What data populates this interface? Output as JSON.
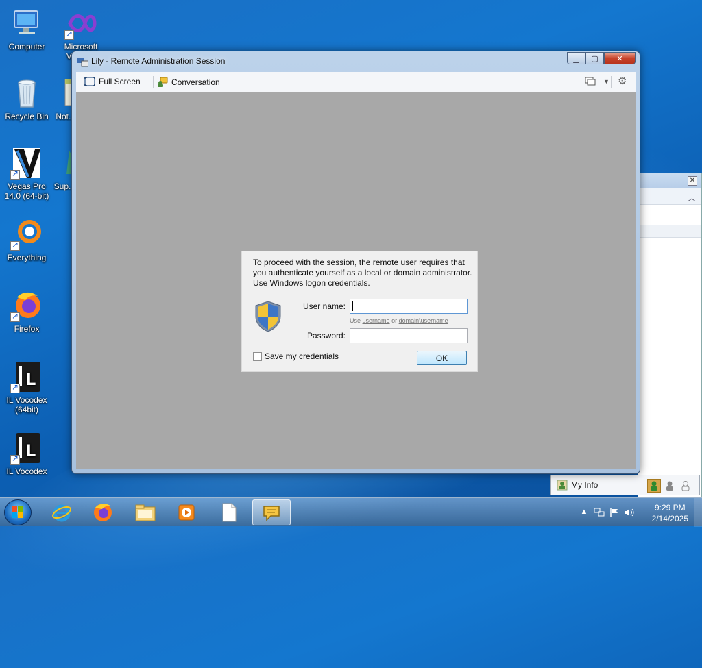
{
  "desktop": {
    "icons": [
      {
        "label": "Computer",
        "icon": "computer-icon"
      },
      {
        "label": "Microsoft Visual...",
        "icon": "visual-studio-icon"
      },
      {
        "label": "Recycle Bin",
        "icon": "recycle-bin-icon"
      },
      {
        "label": "Not...",
        "icon": "notepad-icon"
      },
      {
        "label": "Vegas Pro 14.0 (64-bit)",
        "icon": "vegas-pro-icon"
      },
      {
        "label": "Sup...",
        "icon": "app-icon"
      },
      {
        "label": "Everything",
        "icon": "everything-icon"
      },
      {
        "label": "Firefox",
        "icon": "firefox-icon"
      },
      {
        "label": "IL Vocodex (64bit)",
        "icon": "il-vocodex-icon"
      },
      {
        "label": "IL Vocodex",
        "icon": "il-vocodex-icon"
      }
    ]
  },
  "window": {
    "title": "Lily - Remote Administration Session",
    "toolbar": {
      "full_screen": "Full Screen",
      "conversation": "Conversation"
    }
  },
  "auth_dialog": {
    "message": "To proceed with the session, the remote user requires that you authenticate yourself as a local or domain administrator. Use Windows logon credentials.",
    "username_label": "User name:",
    "username_value": "",
    "hint_prefix": "Use",
    "hint_username": "username",
    "hint_or": "or",
    "hint_domain": "domain\\username",
    "password_label": "Password:",
    "password_value": "",
    "save_credentials": "Save my credentials",
    "save_checked": false,
    "ok": "OK"
  },
  "side_panel": {
    "my_info": "My Info"
  },
  "taskbar": {
    "time": "9:29 PM",
    "date": "2/14/2025",
    "apps": [
      "internet-explorer-icon",
      "firefox-icon",
      "file-explorer-icon",
      "media-player-icon",
      "document-icon",
      "messenger-icon"
    ]
  },
  "colors": {
    "desktop_bg": "#1477cf",
    "client_bg": "#a8a8a8",
    "dialog_bg": "#f0f0f0"
  }
}
